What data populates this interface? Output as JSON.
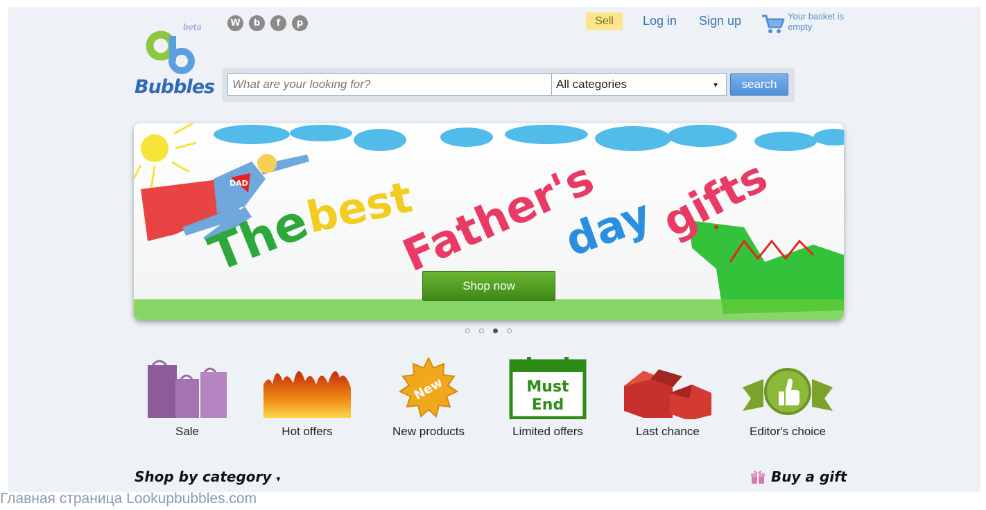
{
  "logo": {
    "beta": "beta",
    "name": "Bubbles"
  },
  "social": [
    {
      "icon": "wordpress-icon",
      "glyph": "W"
    },
    {
      "icon": "blogger-icon",
      "glyph": "b"
    },
    {
      "icon": "facebook-icon",
      "glyph": "f"
    },
    {
      "icon": "pinterest-icon",
      "glyph": "p"
    }
  ],
  "nav": {
    "sell": "Sell",
    "login": "Log in",
    "signup": "Sign up"
  },
  "basket": {
    "icon": "shopping-cart-icon",
    "text": "Your basket is empty"
  },
  "search": {
    "placeholder": "What are your looking for?",
    "category": "All categories",
    "button": "search"
  },
  "banner": {
    "headline": [
      "The",
      "best",
      "Father's",
      "day",
      "gifts"
    ],
    "badge": "DAD",
    "cta": "Shop now",
    "slides": 4,
    "active_slide": 3
  },
  "tiles": [
    {
      "label": "Sale",
      "icon": "shopping-bags-icon"
    },
    {
      "label": "Hot offers",
      "icon": "flames-icon"
    },
    {
      "label": "New products",
      "icon": "new-badge-icon",
      "badge": "New"
    },
    {
      "label": "Limited offers",
      "icon": "calendar-icon",
      "line1": "Must",
      "line2": "End"
    },
    {
      "label": "Last chance",
      "icon": "open-boxes-icon"
    },
    {
      "label": "Editor's choice",
      "icon": "thumbs-up-ribbon-icon"
    }
  ],
  "bottom": {
    "shop_by_category": "Shop by category",
    "buy_gift": "Buy a gift"
  },
  "caption": "Главная страница Lookupbubbles.com",
  "colors": {
    "brand_blue": "#2f6ab8",
    "link_blue": "#3a73b8",
    "sell_yellow": "#fde589",
    "cta_green": "#4f9f22"
  }
}
